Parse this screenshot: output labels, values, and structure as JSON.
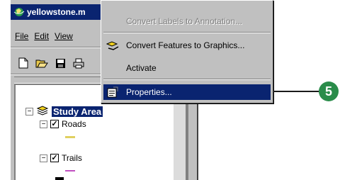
{
  "window": {
    "title": "yellowstone.m",
    "menu": [
      {
        "label": "File",
        "mnemonic_index": 0
      },
      {
        "label": "Edit",
        "mnemonic_index": 0
      },
      {
        "label": "View",
        "mnemonic_index": 0
      }
    ]
  },
  "toolbar": {
    "buttons": [
      "new-document-icon",
      "open-folder-icon",
      "save-icon",
      "print-icon"
    ]
  },
  "toc": {
    "data_frame": "Study Area",
    "layers": [
      {
        "name": "Roads",
        "checked": true,
        "expanded": true,
        "symbol_color": "#e0d060"
      },
      {
        "name": "Trails",
        "checked": true,
        "expanded": true,
        "symbol_color": "#c050c0"
      }
    ]
  },
  "context_menu": {
    "items": [
      {
        "label": "Convert Labels to Annotation...",
        "enabled": false,
        "icon": ""
      },
      {
        "label": "Convert Features to Graphics...",
        "enabled": true,
        "icon": "convert-features-icon"
      },
      {
        "label": "Activate",
        "enabled": true,
        "icon": ""
      },
      {
        "label": "Properties...",
        "enabled": true,
        "selected": true,
        "icon": "properties-icon"
      }
    ]
  },
  "callout": {
    "step": "5",
    "color": "#2a8c4a"
  }
}
